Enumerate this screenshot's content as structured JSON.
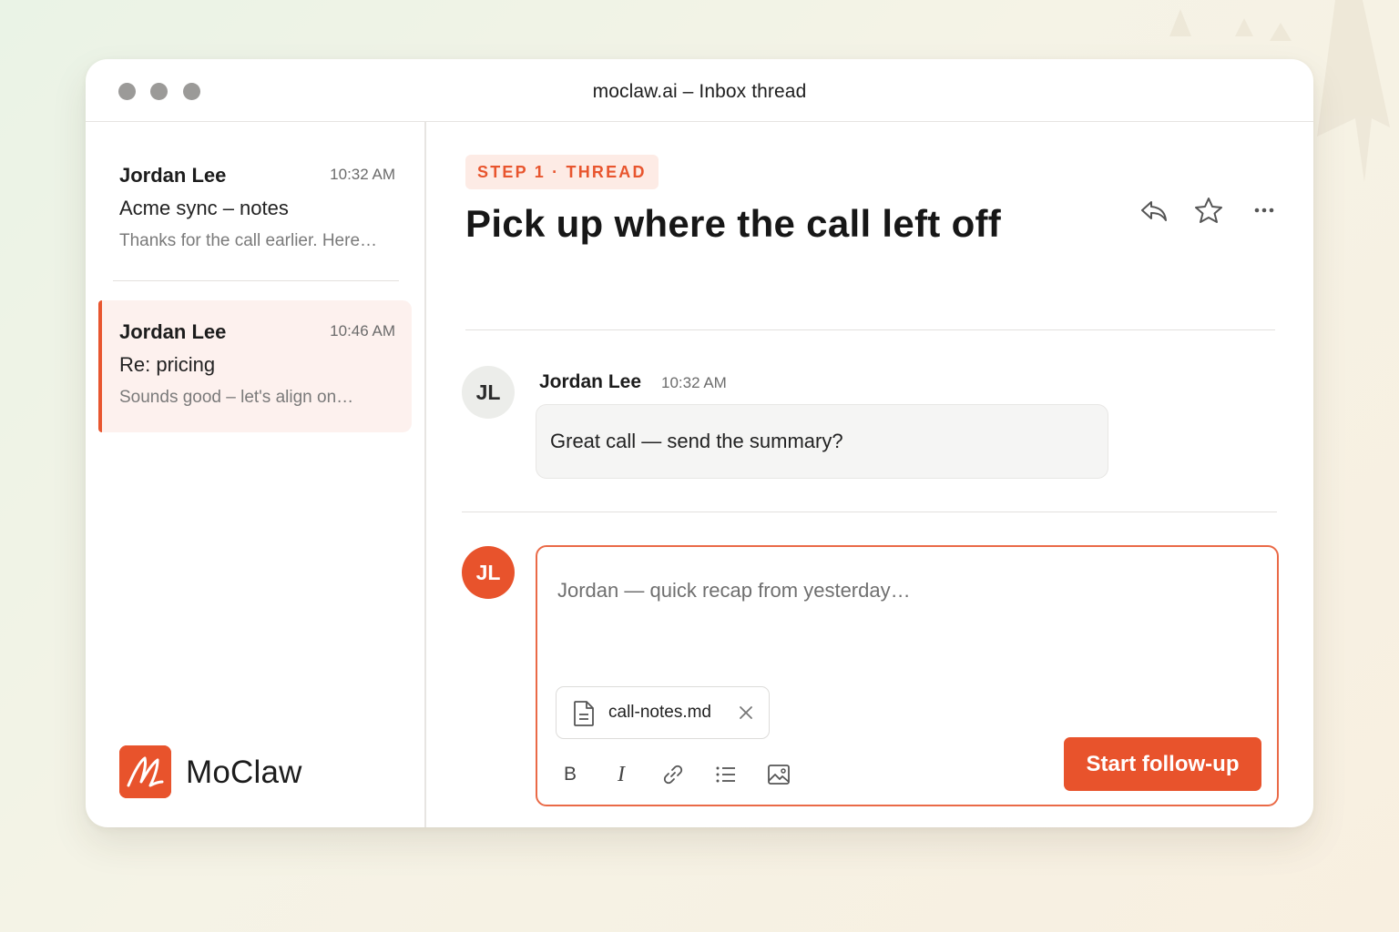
{
  "window": {
    "title": "moclaw.ai – Inbox thread"
  },
  "sidebar": {
    "threads": [
      {
        "sender": "Jordan Lee",
        "time": "10:32 AM",
        "subject": "Acme sync – notes",
        "preview": "Thanks for the call earlier. Here…",
        "selected": false
      },
      {
        "sender": "Jordan Lee",
        "time": "10:46 AM",
        "subject": "Re: pricing",
        "preview": "Sounds good – let's align on…",
        "selected": true
      }
    ],
    "brand": {
      "name": "MoClaw",
      "logo_icon": "moclaw-logo-icon"
    }
  },
  "header": {
    "step_badge": "STEP 1 · THREAD",
    "title": "Pick up where the call left off",
    "actions": [
      {
        "name": "reply",
        "icon": "reply-icon"
      },
      {
        "name": "star",
        "icon": "star-icon"
      },
      {
        "name": "more",
        "icon": "more-horizontal-icon"
      }
    ]
  },
  "message": {
    "avatar_initials": "JL",
    "sender": "Jordan Lee",
    "time": "10:32 AM",
    "body": "Great call — send the summary?"
  },
  "composer": {
    "avatar_initials": "JL",
    "placeholder": "Jordan — quick recap from yesterday…",
    "attachment": {
      "filename": "call-notes.md",
      "icon": "file-icon",
      "remove_icon": "close-icon"
    },
    "toolbar": {
      "bold_label": "B",
      "italic_label": "I",
      "tools": [
        "bold-icon",
        "italic-icon",
        "link-icon",
        "list-icon",
        "image-icon"
      ]
    },
    "send_label": "Start follow-up"
  },
  "colors": {
    "accent": "#e8532c",
    "selected_bg": "#fdf1ee",
    "badge_bg": "#fdebe5",
    "neutral_avatar_bg": "#ecedea"
  }
}
